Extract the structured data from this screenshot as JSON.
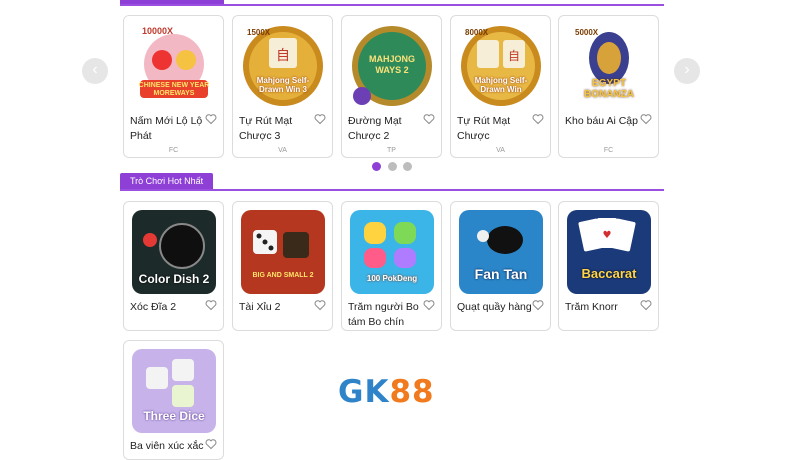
{
  "carousel": {
    "prev_icon": "chevron-left-icon",
    "next_icon": "chevron-right-icon",
    "dots": [
      true,
      false,
      false
    ],
    "games": [
      {
        "title": "Nấm Mới Lộ Lộ Phát",
        "provider": "FC",
        "badge": "10000X",
        "art": "CHINESE NEW YEAR MOREWAYS"
      },
      {
        "title": "Tự Rút Mạt Chược 3",
        "provider": "VA",
        "badge": "1500X",
        "art": "Mahjong Self-Drawn Win 3"
      },
      {
        "title": "Đường Mạt Chược 2",
        "provider": "TP",
        "badge": "",
        "art": "MAHJONG WAYS 2"
      },
      {
        "title": "Tự Rút Mạt Chược",
        "provider": "VA",
        "badge": "8000X",
        "art": "Mahjong Self-Drawn Win"
      },
      {
        "title": "Kho báu Ai Cập",
        "provider": "FC",
        "badge": "5000X",
        "art": "EGYPT BONANZA"
      }
    ]
  },
  "hot_section": {
    "tab_label": "Trò Chơi Hot Nhất",
    "games": [
      {
        "title": "Xóc Đĩa 2",
        "art": "Color Dish 2"
      },
      {
        "title": "Tài Xỉu 2",
        "art": "BIG AND SMALL 2"
      },
      {
        "title": "Trăm người Bo tám Bo chín",
        "art": "100 PokDeng"
      },
      {
        "title": "Quạt quầy hàng",
        "art": "Fan Tan"
      },
      {
        "title": "Trăm Knorr",
        "art": "Baccarat"
      },
      {
        "title": "Ba viên xúc xắc",
        "art": "Three Dice"
      }
    ]
  },
  "logo": {
    "part1": "GK",
    "part2": "88"
  },
  "colors": {
    "accent": "#8e3fd6",
    "logo_blue": "#2f83c8",
    "logo_orange": "#f07a1d"
  }
}
